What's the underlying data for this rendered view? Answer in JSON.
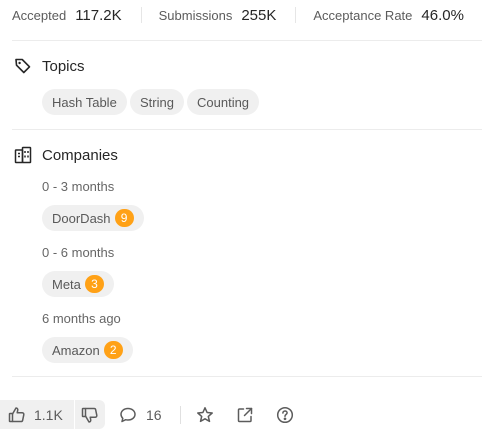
{
  "stats": [
    {
      "label": "Accepted",
      "value": "117.2K"
    },
    {
      "label": "Submissions",
      "value": "255K"
    },
    {
      "label": "Acceptance Rate",
      "value": "46.0%"
    }
  ],
  "topics": {
    "title": "Topics",
    "icon": "tag-icon",
    "tags": [
      "Hash Table",
      "String",
      "Counting"
    ]
  },
  "companies": {
    "title": "Companies",
    "icon": "building-icon",
    "groups": [
      {
        "period": "0 - 3 months",
        "items": [
          {
            "name": "DoorDash",
            "count": "9"
          }
        ]
      },
      {
        "period": "0 - 6 months",
        "items": [
          {
            "name": "Meta",
            "count": "3"
          }
        ]
      },
      {
        "period": "6 months ago",
        "items": [
          {
            "name": "Amazon",
            "count": "2"
          }
        ]
      }
    ]
  },
  "actions": {
    "likes": "1.1K",
    "comments": "16",
    "icons": [
      "thumbs-up-icon",
      "thumbs-down-icon",
      "comment-icon",
      "star-icon",
      "share-icon",
      "help-icon"
    ]
  },
  "colors": {
    "badge": "#ffa116",
    "pill_bg": "#f0f0f0",
    "divider": "#ececec"
  }
}
